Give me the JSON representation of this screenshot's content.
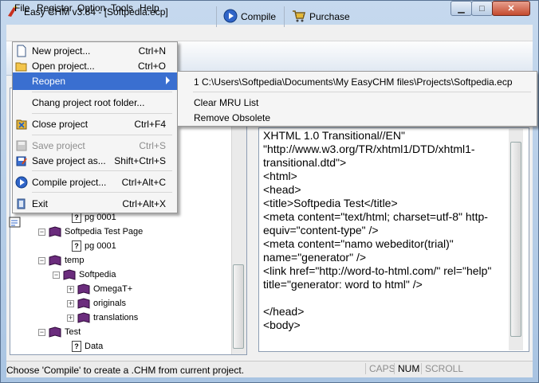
{
  "window": {
    "title": "Easy CHM v3.84 - [Softpedia.ecp]",
    "minimize_glyph": "▁",
    "maximize_glyph": "□",
    "close_glyph": "✕"
  },
  "menubar": {
    "items": [
      "File",
      "Register",
      "Option",
      "Tools",
      "Help"
    ]
  },
  "toolbar": {
    "compile_label": "Compile",
    "purchase_label": "Purchase"
  },
  "file_menu": {
    "new_project": {
      "label": "New project...",
      "shortcut": "Ctrl+N"
    },
    "open_project": {
      "label": "Open project...",
      "shortcut": "Ctrl+O"
    },
    "reopen": {
      "label": "Reopen"
    },
    "change_root": {
      "label": "Chang project root folder..."
    },
    "close_project": {
      "label": "Close project",
      "shortcut": "Ctrl+F4"
    },
    "save_project": {
      "label": "Save project",
      "shortcut": "Ctrl+S"
    },
    "save_project_as": {
      "label": "Save project as...",
      "shortcut": "Shift+Ctrl+S"
    },
    "compile_project": {
      "label": "Compile project...",
      "shortcut": "Ctrl+Alt+C"
    },
    "exit": {
      "label": "Exit",
      "shortcut": "Ctrl+Alt+X"
    }
  },
  "reopen_submenu": {
    "recent_1": "1 C:\\Users\\Softpedia\\Documents\\My EasyCHM files\\Projects\\Softpedia.ecp",
    "clear_mru": "Clear MRU List",
    "remove_obsolete": "Remove Obsolete"
  },
  "tree": {
    "items": [
      {
        "label": "pg 0001",
        "kind": "page"
      },
      {
        "label": "Softpedia Test Page",
        "kind": "book"
      },
      {
        "label": "pg 0001",
        "kind": "page"
      },
      {
        "label": "temp",
        "kind": "book"
      },
      {
        "label": "Softpedia",
        "kind": "book"
      },
      {
        "label": "OmegaT+",
        "kind": "book"
      },
      {
        "label": "originals",
        "kind": "book"
      },
      {
        "label": "translations",
        "kind": "book"
      },
      {
        "label": "Test",
        "kind": "book"
      },
      {
        "label": "Data",
        "kind": "page"
      }
    ]
  },
  "editor": {
    "lines": [
      "XHTML 1.0 Transitional//EN\"",
      "\"http://www.w3.org/TR/xhtml1/DTD/xhtml1-transitional.dtd\">",
      "<html>",
      "<head>",
      "<title>Softpedia Test</title>",
      "<meta content=\"text/html; charset=utf-8\" http-equiv=\"content-type\" />",
      "<meta content=\"namo webeditor(trial)\" name=\"generator\" />",
      "<link href=\"http://word-to-html.com/\" rel=\"help\" title=\"generator: word to html\" />",
      "",
      "</head>",
      "<body>"
    ]
  },
  "statusbar": {
    "message": "Choose 'Compile' to create a .CHM from current project.",
    "caps": "CAPS",
    "num": "NUM",
    "scroll": "SCROLL"
  },
  "colors": {
    "menu_highlight": "#3a6fd0",
    "book_purple": "#6b2c7d",
    "disabled_text": "#8d8d8d"
  }
}
